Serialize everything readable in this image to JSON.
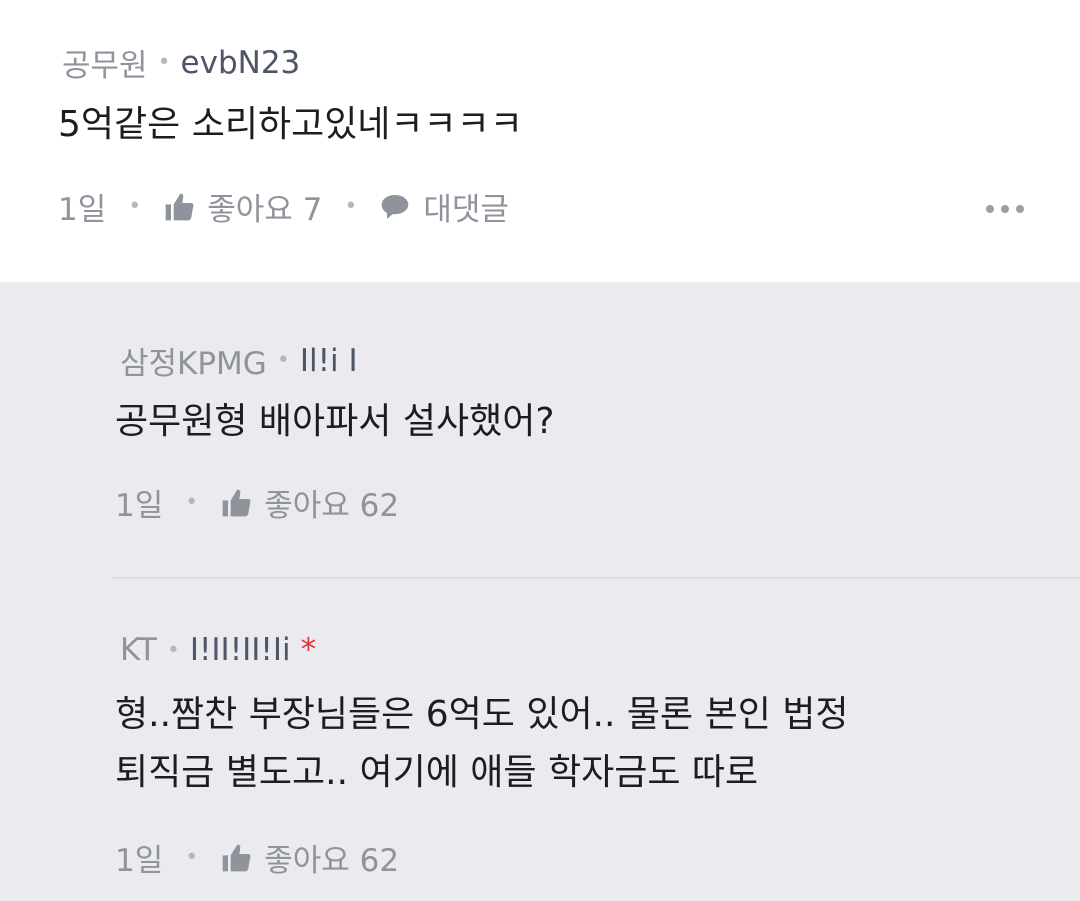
{
  "comment": {
    "company": "공무원",
    "nickname": "evbN23",
    "text": "5억같은 소리하고있네ㅋㅋㅋㅋ",
    "time": "1일",
    "like_label": "좋아요 7",
    "reply_label": "대댓글",
    "more_icon": "more-dots-icon"
  },
  "replies": [
    {
      "company": "삼정KPMG",
      "nickname": "Il!i I",
      "text_lines": [
        "공무원형 배아파서 설사했어?"
      ],
      "time": "1일",
      "like_label": "좋아요 62"
    },
    {
      "company": "KT",
      "nickname": "I!II!II!Ii",
      "badge": "*",
      "text_lines": [
        "형..짬찬 부장님들은 6억도 있어.. 물론 본인 법정",
        "퇴직금 별도고.. 여기에 애들 학자금도 따로"
      ],
      "time": "1일",
      "like_label": "좋아요 62"
    }
  ],
  "colors": {
    "reply_bg": "#ebebef",
    "badge": "#e0343a"
  }
}
